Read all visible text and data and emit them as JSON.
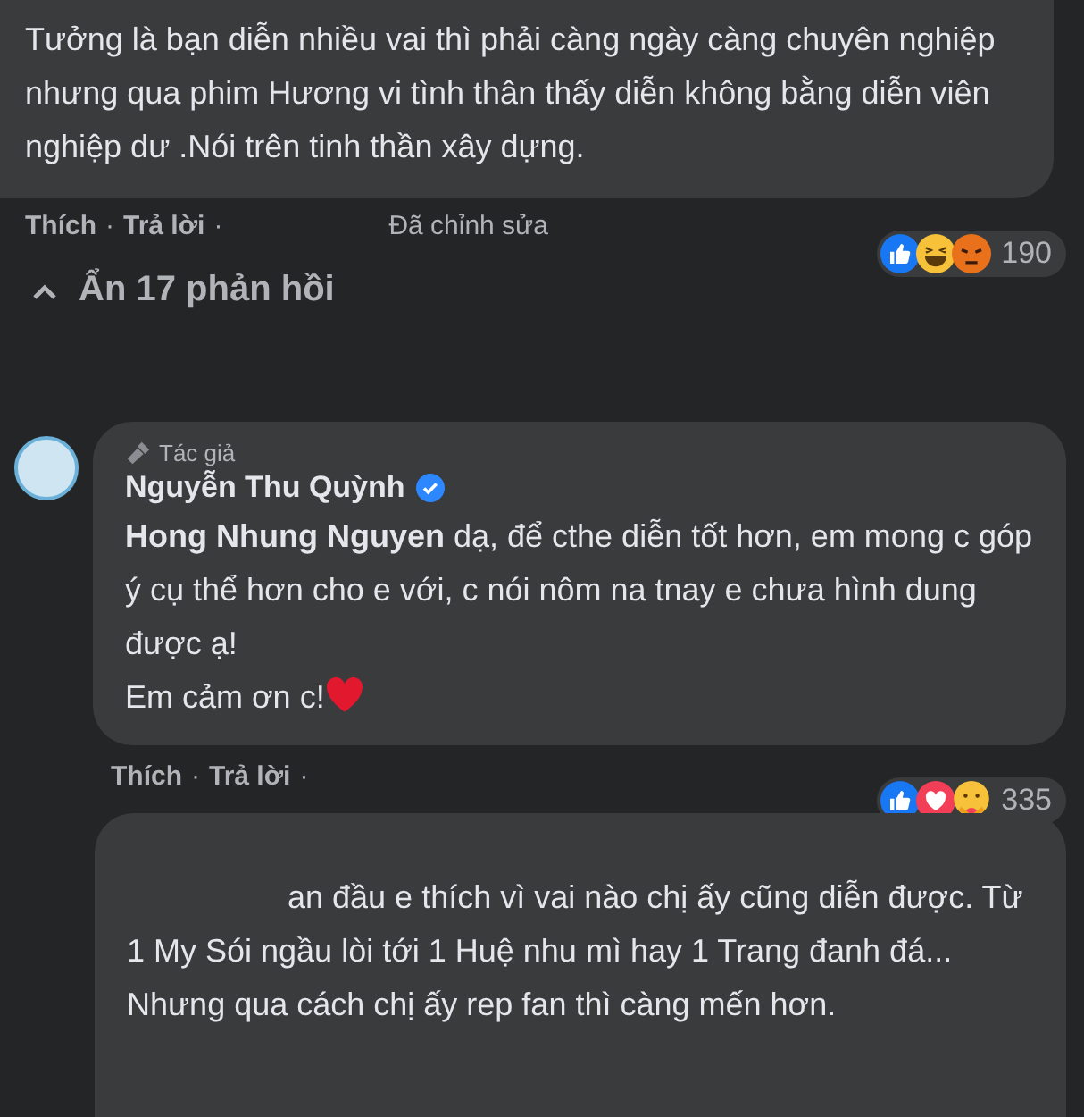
{
  "comments": [
    {
      "kind": "top",
      "paragraphs": [
        "Tưởng là bạn diễn nhiều vai thì phải càng ngày càng chuyên nghiệp nhưng qua phim Hương vi tình thân thấy diễn không bằng diễn viên nghiệp dư .Nói trên tinh thần xây dựng."
      ],
      "reactions": {
        "icons": [
          {
            "kind": "like"
          },
          {
            "kind": "haha"
          },
          {
            "kind": "angry"
          }
        ],
        "count": "190"
      },
      "actions": [
        "Thích",
        "Trả lời"
      ],
      "separator": "·",
      "edited": "Đã chỉnh sửa"
    },
    {
      "kind": "reply",
      "author": "Nguyễn Thu Quỳnh",
      "author_badge": "Tác giả",
      "paragraphs": [
        "**Hong Nhung Nguyen** dạ, để cthe diễn tốt hơn, em mong c góp ý cụ thể hơn cho e với, c nói nôm na tnay e chưa hình dung được ạ!",
        "Em cảm ơn c!"
      ],
      "heart": true,
      "reactions": {
        "icons": [
          {
            "kind": "like"
          },
          {
            "kind": "love"
          },
          {
            "kind": "care"
          }
        ],
        "count": "335"
      },
      "actions": [
        "Thích",
        "Trả lời"
      ],
      "separator": "·"
    },
    {
      "kind": "partial",
      "paragraphs": [
        "an đầu e thích vì vai nào chị ấy cũng diễn được. Từ 1 My Sói ngầu lòi tới 1 Huệ nhu mì hay 1 Trang đanh đá...",
        "Nhưng qua cách chị ấy rep fan thì càng mến hơn."
      ]
    }
  ],
  "toggle": {
    "label": "Ẩn 17 phản hồi",
    "expanded": true
  }
}
